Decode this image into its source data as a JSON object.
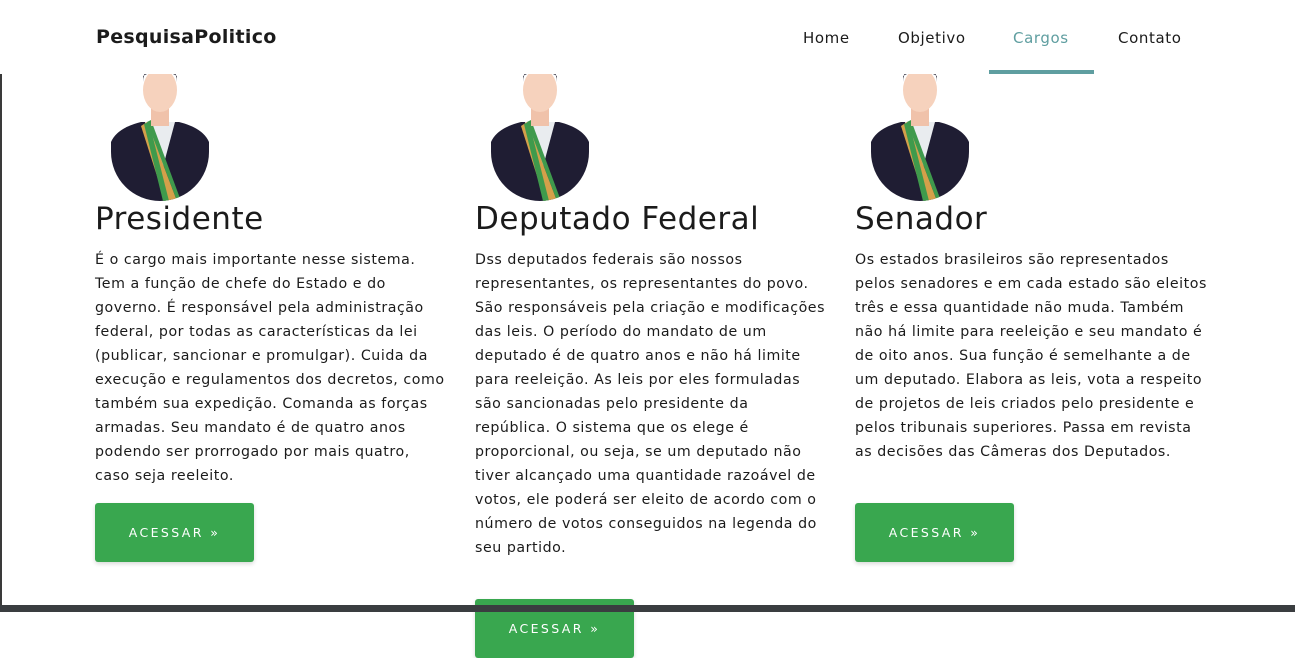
{
  "navbar": {
    "brand": "PesquisaPolitico",
    "links": [
      {
        "label": "Home"
      },
      {
        "label": "Objetivo"
      },
      {
        "label": "Cargos",
        "active": true
      },
      {
        "label": "Contato"
      }
    ]
  },
  "cards": [
    {
      "title": "Presidente",
      "text": "É o cargo mais importante nesse sistema. Tem a função de chefe do Estado e do governo. É responsável pela administração federal, por todas as características da lei (publicar, sancionar e promulgar). Cuida da execução e regulamentos dos decretos, como também sua expedição. Comanda as forças armadas. Seu mandato é de quatro anos podendo ser prorrogado por mais quatro, caso seja reeleito.",
      "button": "ACESSAR »"
    },
    {
      "title": "Deputado Federal",
      "text": "Dss deputados federais são nossos representantes, os representantes do povo. São responsáveis pela criação e modificações das leis. O período do mandato de um deputado é de quatro anos e não há limite para reeleição. As leis por eles formuladas são sancionadas pelo presidente da república. O sistema que os elege é proporcional, ou seja, se um deputado não tiver alcançado uma quantidade razoável de votos, ele poderá ser eleito de acordo com o número de votos conseguidos na legenda do seu partido.",
      "button": "ACESSAR »"
    },
    {
      "title": "Senador",
      "text": "Os estados brasileiros são representados pelos senadores e em cada estado são eleitos três e essa quantidade não muda. Também não há limite para reeleição e seu mandato é de oito anos. Sua função é semelhante a de um deputado. Elabora as leis, vota a respeito de projetos de leis criados pelo presidente e pelos tribunais superiores. Passa em revista as decisões das Câmeras dos Deputados.",
      "button": "ACESSAR »"
    }
  ],
  "colors": {
    "accent": "#5f9ea0",
    "button": "#39a74f",
    "suit": "#1f1d33",
    "sash_green": "#3f9a4c",
    "sash_gold": "#d4a04a",
    "skin": "#f6d2bd"
  },
  "icons": {
    "avatar": "politician-avatar-icon"
  }
}
